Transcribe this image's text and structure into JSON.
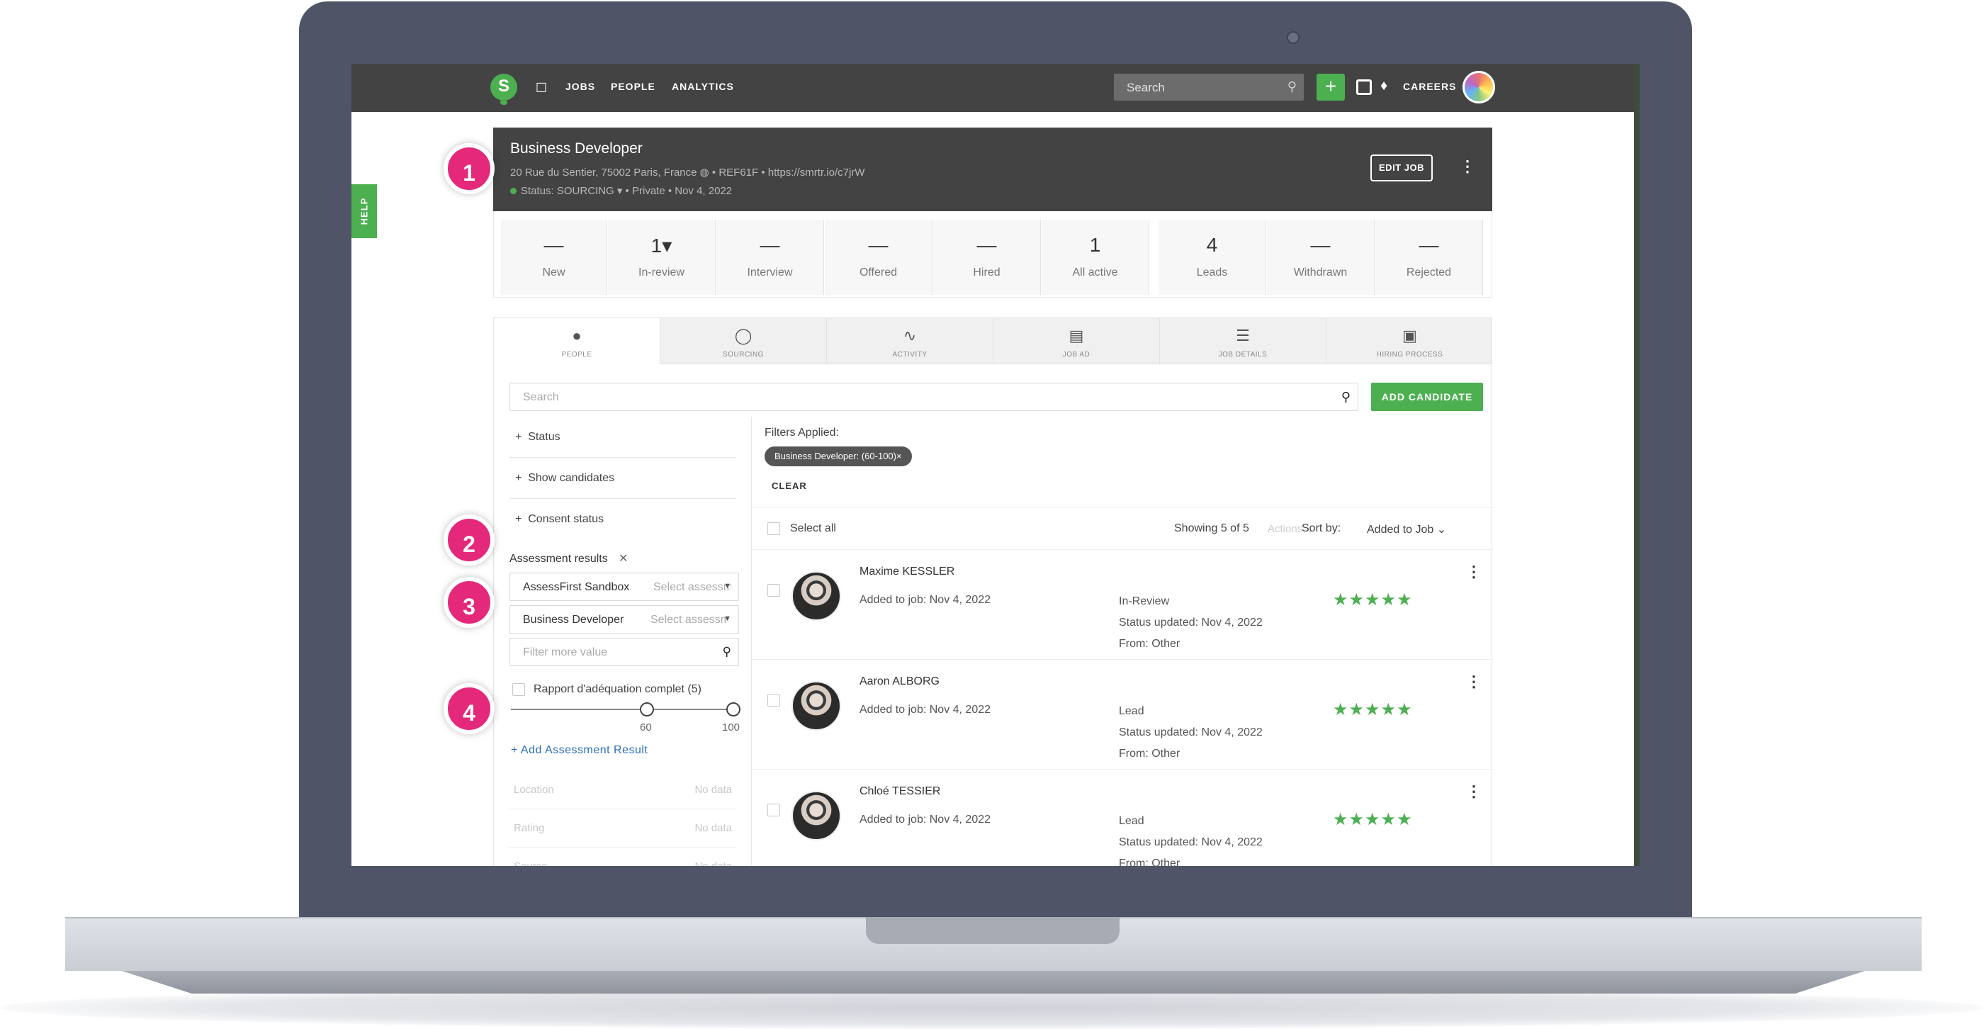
{
  "nav": {
    "logo_letter": "S",
    "links": [
      "JOBS",
      "PEOPLE",
      "ANALYTICS"
    ],
    "search_placeholder": "Search",
    "careers": "CAREERS"
  },
  "help": "HELP",
  "job": {
    "title": "Business Developer",
    "meta": "20 Rue du Sentier, 75002 Paris, France  ◍  •  REF61F  •  https://smrtr.io/c7jrW",
    "status": "Status: SOURCING ▾  •  Private  •  Nov 4, 2022",
    "edit_label": "EDIT JOB"
  },
  "stats": [
    {
      "value": "—",
      "label": "New"
    },
    {
      "value": "1▾",
      "label": "In-review"
    },
    {
      "value": "—",
      "label": "Interview"
    },
    {
      "value": "—",
      "label": "Offered"
    },
    {
      "value": "—",
      "label": "Hired"
    },
    {
      "value": "1",
      "label": "All active"
    },
    {
      "value": "4",
      "label": "Leads"
    },
    {
      "value": "—",
      "label": "Withdrawn"
    },
    {
      "value": "—",
      "label": "Rejected"
    }
  ],
  "tabs": [
    {
      "label": "PEOPLE",
      "icon": "person-icon"
    },
    {
      "label": "SOURCING",
      "icon": "sourcing-icon"
    },
    {
      "label": "ACTIVITY",
      "icon": "activity-icon"
    },
    {
      "label": "JOB AD",
      "icon": "job-ad-icon"
    },
    {
      "label": "JOB DETAILS",
      "icon": "sliders-icon"
    },
    {
      "label": "HIRING PROCESS",
      "icon": "id-card-icon"
    }
  ],
  "people": {
    "search_placeholder": "Search",
    "add_candidate": "ADD CANDIDATE"
  },
  "filters": {
    "status": "Status",
    "show_candidates": "Show candidates",
    "consent_status": "Consent status",
    "assessment_title": "Assessment results",
    "select1_value": "AssessFirst Sandbox",
    "select1_placeholder": "Select assessment",
    "select2_value": "Business Developer",
    "select2_placeholder": "Select assessment",
    "filter_more": "Filter more value",
    "rapport": "Rapport d'adéquation complet (5)",
    "range_min": 60,
    "range_max": 100,
    "add_assessment": "+ Add Assessment Result",
    "location_label": "Location",
    "location_value": "No data",
    "rating_label": "Rating",
    "rating_value": "No data",
    "source_label": "Source",
    "source_value": "No data"
  },
  "results": {
    "filters_applied": "Filters Applied:",
    "chip": "Business Developer: (60-100)×",
    "clear": "CLEAR",
    "select_all": "Select all",
    "showing": "Showing 5 of 5",
    "actions": "Actions ⌄",
    "sort_label": "Sort by:",
    "sort_value": "Added to Job ⌄"
  },
  "candidates": [
    {
      "name": "Maxime KESSLER",
      "added": "Added to job: Nov 4, 2022",
      "stage": "In-Review",
      "updated": "Status updated: Nov 4, 2022",
      "from": "From: Other",
      "rating": 5
    },
    {
      "name": "Aaron ALBORG",
      "added": "Added to job: Nov 4, 2022",
      "stage": "Lead",
      "updated": "Status updated: Nov 4, 2022",
      "from": "From: Other",
      "rating": 5
    },
    {
      "name": "Chloé TESSIER",
      "added": "Added to job: Nov 4, 2022",
      "stage": "Lead",
      "updated": "Status updated: Nov 4, 2022",
      "from": "From: Other",
      "rating": 5
    }
  ],
  "badges": [
    "1",
    "2",
    "3",
    "4"
  ],
  "colors": {
    "accent": "#4caf50",
    "badge": "#e4287a",
    "header": "#434343"
  }
}
